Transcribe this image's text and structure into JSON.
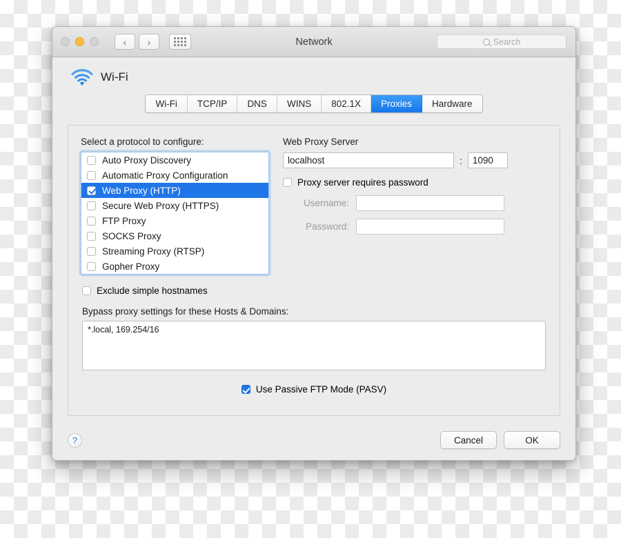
{
  "window": {
    "title": "Network",
    "search_placeholder": "Search",
    "traffic_lights": [
      "close",
      "minimize",
      "maximize"
    ],
    "nav_back": "‹",
    "nav_forward": "›"
  },
  "device": {
    "name": "Wi-Fi",
    "icon": "wifi-icon"
  },
  "tabs": [
    {
      "label": "Wi-Fi",
      "active": false
    },
    {
      "label": "TCP/IP",
      "active": false
    },
    {
      "label": "DNS",
      "active": false
    },
    {
      "label": "WINS",
      "active": false
    },
    {
      "label": "802.1X",
      "active": false
    },
    {
      "label": "Proxies",
      "active": true
    },
    {
      "label": "Hardware",
      "active": false
    }
  ],
  "protocols": {
    "label": "Select a protocol to configure:",
    "items": [
      {
        "label": "Auto Proxy Discovery",
        "checked": false,
        "selected": false
      },
      {
        "label": "Automatic Proxy Configuration",
        "checked": false,
        "selected": false
      },
      {
        "label": "Web Proxy (HTTP)",
        "checked": true,
        "selected": true
      },
      {
        "label": "Secure Web Proxy (HTTPS)",
        "checked": false,
        "selected": false
      },
      {
        "label": "FTP Proxy",
        "checked": false,
        "selected": false
      },
      {
        "label": "SOCKS Proxy",
        "checked": false,
        "selected": false
      },
      {
        "label": "Streaming Proxy (RTSP)",
        "checked": false,
        "selected": false
      },
      {
        "label": "Gopher Proxy",
        "checked": false,
        "selected": false
      }
    ]
  },
  "proxy_server": {
    "title": "Web Proxy Server",
    "host": "localhost",
    "separator": ":",
    "port": "1090",
    "requires_password_label": "Proxy server requires password",
    "requires_password_checked": false,
    "username_label": "Username:",
    "username_value": "",
    "password_label": "Password:",
    "password_value": ""
  },
  "bypass": {
    "exclude_label": "Exclude simple hostnames",
    "exclude_checked": false,
    "list_label": "Bypass proxy settings for these Hosts & Domains:",
    "list_value": "*.local, 169.254/16"
  },
  "pasv": {
    "label": "Use Passive FTP Mode (PASV)",
    "checked": true
  },
  "footer": {
    "help_label": "?",
    "cancel_label": "Cancel",
    "ok_label": "OK"
  },
  "colors": {
    "accent_blue": "#1f76e8",
    "tab_active": "#2a8cf0",
    "window_bg": "#ececec"
  }
}
